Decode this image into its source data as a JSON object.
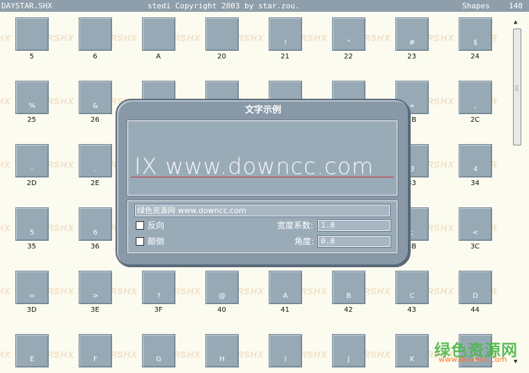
{
  "titlebar": {
    "file": "DAYSTAR.SHX",
    "copyright": "stedi Copyright 2003 by star.zou.",
    "mode": "Shapes",
    "count": "140"
  },
  "watermark_text": "SHX VIEWER",
  "glyph_rows": [
    [
      {
        "code": "5",
        "glyph": ""
      },
      {
        "code": "6",
        "glyph": ""
      },
      {
        "code": "A",
        "glyph": ""
      },
      {
        "code": "20",
        "glyph": ""
      },
      {
        "code": "21",
        "glyph": "!"
      },
      {
        "code": "22",
        "glyph": "\""
      },
      {
        "code": "23",
        "glyph": "#"
      },
      {
        "code": "24",
        "glyph": "$"
      }
    ],
    [
      {
        "code": "25",
        "glyph": "%"
      },
      {
        "code": "26",
        "glyph": "&"
      },
      {
        "code": "",
        "glyph": ""
      },
      {
        "code": "",
        "glyph": ""
      },
      {
        "code": "",
        "glyph": ""
      },
      {
        "code": "",
        "glyph": ""
      },
      {
        "code": "2B",
        "glyph": "+"
      },
      {
        "code": "2C",
        "glyph": ","
      }
    ],
    [
      {
        "code": "2D",
        "glyph": "-"
      },
      {
        "code": "2E",
        "glyph": "."
      },
      {
        "code": "",
        "glyph": ""
      },
      {
        "code": "",
        "glyph": ""
      },
      {
        "code": "",
        "glyph": ""
      },
      {
        "code": "",
        "glyph": ""
      },
      {
        "code": "33",
        "glyph": "3"
      },
      {
        "code": "34",
        "glyph": "4"
      }
    ],
    [
      {
        "code": "35",
        "glyph": "5"
      },
      {
        "code": "36",
        "glyph": "6"
      },
      {
        "code": "",
        "glyph": ""
      },
      {
        "code": "",
        "glyph": ""
      },
      {
        "code": "",
        "glyph": ""
      },
      {
        "code": "",
        "glyph": ""
      },
      {
        "code": "3B",
        "glyph": ";"
      },
      {
        "code": "3C",
        "glyph": "<"
      }
    ],
    [
      {
        "code": "3D",
        "glyph": "="
      },
      {
        "code": "3E",
        "glyph": ">"
      },
      {
        "code": "3F",
        "glyph": "?"
      },
      {
        "code": "40",
        "glyph": "@"
      },
      {
        "code": "41",
        "glyph": "A"
      },
      {
        "code": "42",
        "glyph": "B"
      },
      {
        "code": "43",
        "glyph": "C"
      },
      {
        "code": "44",
        "glyph": "D"
      }
    ],
    [
      {
        "code": "",
        "glyph": "E"
      },
      {
        "code": "",
        "glyph": "F"
      },
      {
        "code": "",
        "glyph": "G"
      },
      {
        "code": "",
        "glyph": "H"
      },
      {
        "code": "",
        "glyph": "I"
      },
      {
        "code": "",
        "glyph": "J"
      },
      {
        "code": "",
        "glyph": "K"
      },
      {
        "code": "",
        "glyph": "L"
      }
    ]
  ],
  "dialog": {
    "title": "文字示例",
    "preview_text": "IX www.downcc.com",
    "text_value": "绿色资源网 www.downcc.com",
    "reverse_label": "反向",
    "upside_down_label": "颠倒",
    "width_factor_label": "宽度系数:",
    "width_factor_value": "1.0",
    "angle_label": "角度:",
    "angle_value": "0.0"
  },
  "brand": {
    "logo_text": "绿色资源网",
    "logo_url": "www.downcc.com"
  }
}
